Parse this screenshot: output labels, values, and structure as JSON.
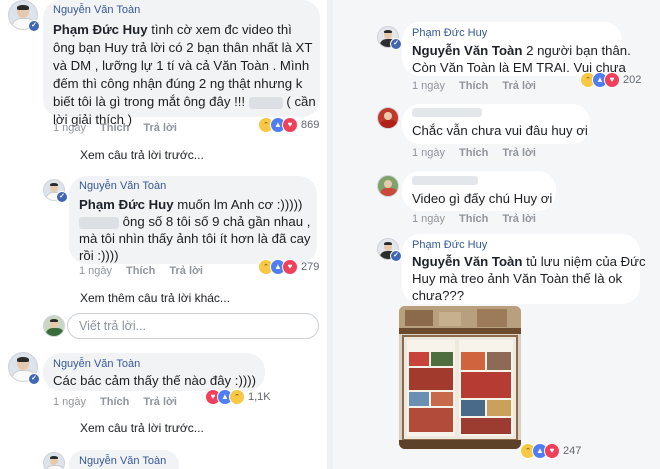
{
  "left": {
    "c1": {
      "author": "Nguyễn Văn Toàn",
      "mention": "Phạm Đức Huy",
      "line1": " tình cờ xem đc video thì",
      "line2": "ông bạn Huy trả lời có 2 bạn thân nhất là XT",
      "line3": "và DM , lưỡng lự 1 tí và cả Văn Toàn . Mình",
      "line4": "đếm thì công nhận đúng 2 ng thật nhưng k",
      "line5a": "biết tôi là gì trong mắt ông đây !!! ",
      "line5b": " ( cần",
      "line6": "lời giải thích )",
      "time": "1 ngày",
      "like": "Thích",
      "reply": "Trả lời",
      "count": "869"
    },
    "view_prev_1": "Xem câu trả lời trước...",
    "c2": {
      "author": "Nguyễn Văn Toàn",
      "mention": "Phạm Đức Huy",
      "line1": " muốn lm Anh cơ :)))))",
      "line2b": " ông số 8 tôi số 9 chả gần nhau ,",
      "line3": "mà tôi nhìn thấy ảnh tôi ít hơn là đã cay",
      "line4": "rồi :))))",
      "time": "1 ngày",
      "like": "Thích",
      "reply": "Trả lời",
      "count": "279"
    },
    "view_more": "Xem thêm câu trả lời khác...",
    "reply_placeholder": "Viết trả lời...",
    "c3": {
      "author": "Nguyễn Văn Toàn",
      "line1": "Các bác cảm thấy thế nào đây :))))",
      "time": "1 ngày",
      "like": "Thích",
      "reply": "Trả lời",
      "count": "1,1K"
    },
    "view_prev_2": "Xem câu trả lời trước...",
    "c4": {
      "author": "Nguyễn Văn Toàn"
    }
  },
  "right": {
    "r1": {
      "author": "Phạm Đức Huy",
      "mention": "Nguyễn Văn Toàn",
      "line1": " 2 người bạn thân.",
      "line2": "Còn Văn Toàn là EM TRAI. Vui chưa",
      "time": "1 ngày",
      "like": "Thích",
      "reply": "Trả lời",
      "count": "202"
    },
    "r2": {
      "line1": "Chắc vẫn chưa vui đâu huy ơi",
      "time": "1 ngày",
      "like": "Thích",
      "reply": "Trả lời"
    },
    "r3": {
      "line1": "Video gì đấy chú Huy ơi",
      "time": "1 ngày",
      "like": "Thích",
      "reply": "Trả lời"
    },
    "r4": {
      "author": "Phạm Đức Huy",
      "mention": "Nguyễn Văn Toàn",
      "line1": " tủ lưu niệm của Đức",
      "line2": "Huy mà treo ảnh Văn Toàn thế là ok",
      "line3": "chưa???",
      "count": "247"
    }
  },
  "colors": {
    "link": "#365899",
    "bubble": "#f2f3f5",
    "like": "#4f7df3",
    "love": "#f0405a",
    "haha": "#f7c844"
  },
  "icons": [
    "verified-badge-icon",
    "like-reaction-icon",
    "love-reaction-icon",
    "haha-reaction-icon"
  ]
}
